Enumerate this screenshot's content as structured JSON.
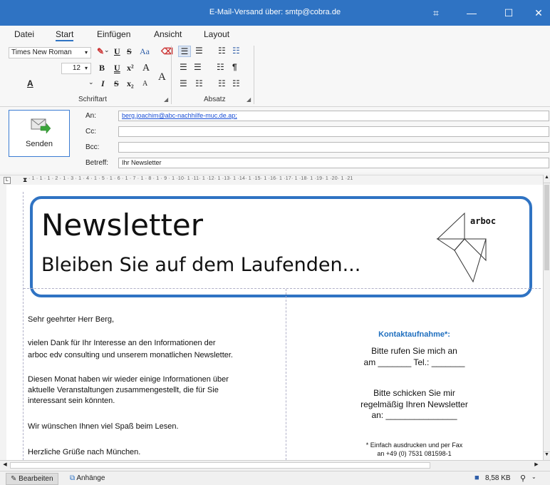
{
  "window": {
    "title": "E-Mail-Versand über: smtp@cobra.de",
    "controls": {
      "snap": "⌗",
      "minimize": "—",
      "maximize": "☐",
      "close": "✕"
    }
  },
  "menu": {
    "items": [
      "Datei",
      "Start",
      "Einfügen",
      "Ansicht",
      "Layout"
    ],
    "active": "Start"
  },
  "ribbon": {
    "font_name": "Times New Roman",
    "font_size": "12",
    "group_font": "Schriftart",
    "group_paragraph": "Absatz",
    "buttons": {
      "underline": "U",
      "strike": "S",
      "case": "Aa",
      "bold": "B",
      "double_underline": "U",
      "superscript": "x²",
      "grow": "A",
      "italic": "I",
      "subscript": "x₂",
      "shrink": "A",
      "big_a": "A",
      "font_color": "A",
      "paragraph": "¶"
    }
  },
  "email": {
    "send_label": "Senden",
    "labels": {
      "to": "An:",
      "cc": "Cc:",
      "bcc": "Bcc:",
      "subject": "Betreff:"
    },
    "to": "berg.joachim@abc-nachhilfe-muc.de.ap;",
    "cc": "",
    "bcc": "",
    "subject": "Ihr Newsletter"
  },
  "ruler": {
    "text": "· 1 · 1 · 1 · 2 · 1 · 3 · 1 · 4 · 1 · 5 · 1 · 6 · 1 · 7 · 1 · 8 · 1 · 9 · 1 ·10· 1 ·11· 1 ·12· 1 ·13· 1 ·14· 1 ·15· 1 ·16· 1 ·17· 1 ·18· 1 ·19· 1 ·20· 1 ·21"
  },
  "newsletter": {
    "title": "Newsletter",
    "subtitle": "Bleiben Sie auf dem Laufenden...",
    "logo_text": "arboc",
    "greeting": "Sehr geehrter Herr Berg,",
    "p1_line1": "vielen Dank für Ihr Interesse an den Informationen der",
    "p1_line2": "arboc edv consulting und unserem monatlichen Newsletter.",
    "p2_line1": "Diesen Monat haben wir wieder einige Informationen über",
    "p2_line2": "aktuelle Veranstaltungen zusammengestellt, die für Sie",
    "p2_line3": "interessant sein könnten.",
    "p3": "Wir wünschen Ihnen viel Spaß beim Lesen.",
    "closing": "Herzliche Grüße nach München.",
    "contact_title": "Kontaktaufnahme*:",
    "contact_call": "Bitte rufen Sie mich an",
    "contact_call_line": "am _______ Tel.: _______",
    "contact_send1": "Bitte schicken Sie mir",
    "contact_send2": "regelmäßig Ihren Newsletter",
    "contact_send3": "an: _______________",
    "footnote1": "* Einfach ausdrucken und  per Fax",
    "footnote2": "an +49 (0) 7531 081598-1"
  },
  "status": {
    "tab_edit": "Bearbeiten",
    "tab_attach": "Anhänge",
    "size": "8,58 KB"
  },
  "colors": {
    "accent": "#2f73c3",
    "link": "#1a4fd6",
    "contact_title": "#1f6fbf"
  }
}
